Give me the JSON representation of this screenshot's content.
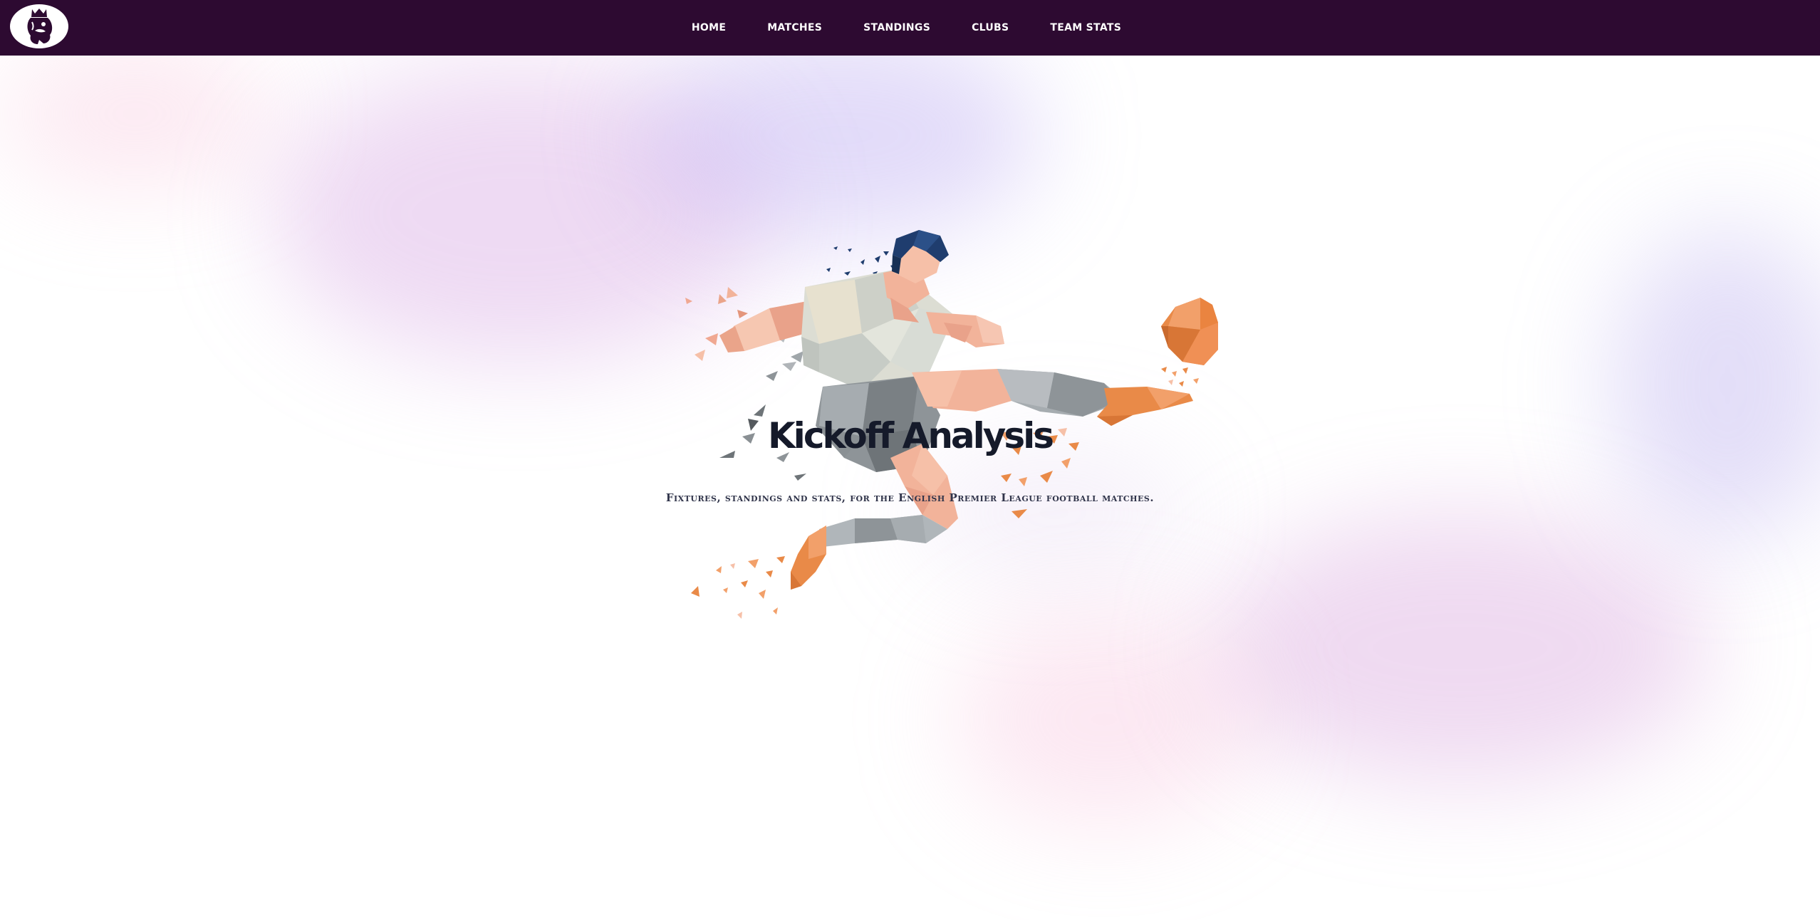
{
  "nav": {
    "logo_icon": "premier-league-lion-icon",
    "links": [
      {
        "label": "Home"
      },
      {
        "label": "Matches"
      },
      {
        "label": "Standings"
      },
      {
        "label": "Clubs"
      },
      {
        "label": "Team Stats"
      }
    ]
  },
  "hero": {
    "title": "Kickoff Analysis",
    "subtitle": "Fixtures, standings and stats, for the English Premier League football matches.",
    "illustration_icon": "low-poly-footballer-kicking-icon"
  },
  "colors": {
    "navbar": "#2d0a31",
    "title": "#151a2a",
    "accent_orange": "#e98a48",
    "hair_navy": "#1f3d6e"
  }
}
